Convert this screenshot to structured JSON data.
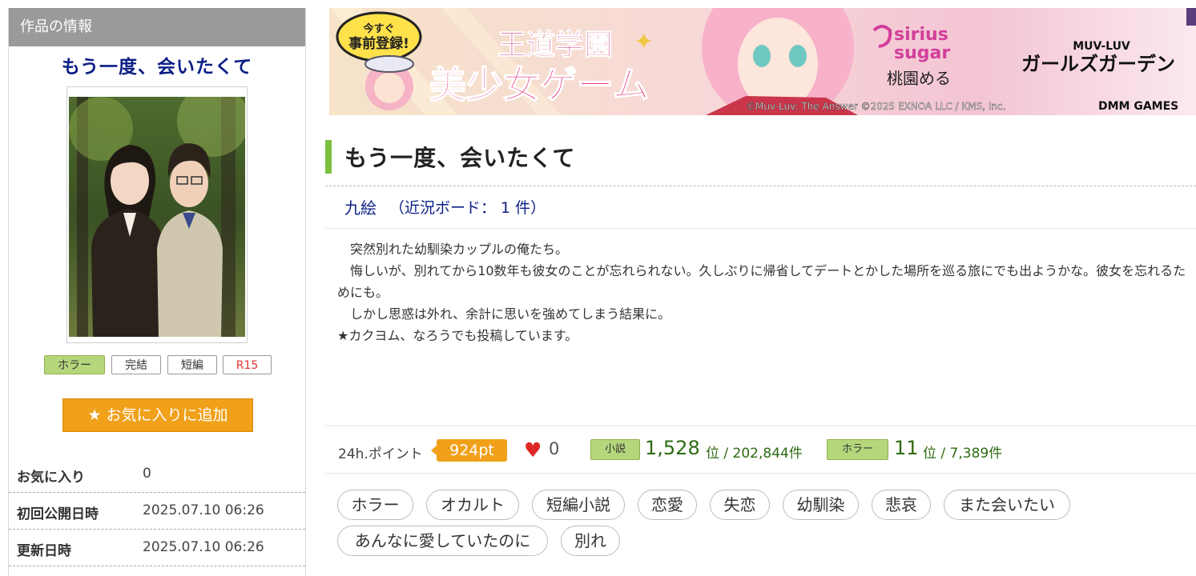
{
  "sidebar": {
    "header": "作品の情報",
    "title": "もう一度、会いたくて",
    "tags": [
      "ホラー",
      "完結",
      "短編",
      "R15"
    ],
    "favorite_button": "お気に入りに追加",
    "info": [
      {
        "label": "お気に入り",
        "value": "0"
      },
      {
        "label": "初回公開日時",
        "value": "2025.07.10 06:26"
      },
      {
        "label": "更新日時",
        "value": "2025.07.10 06:26"
      }
    ]
  },
  "banner": {
    "badge_line1": "今すぐ",
    "badge_line2": "事前登録!",
    "title1": "王道学園",
    "title2": "美少女ゲーム",
    "brand_top": "sirius",
    "brand_bottom": "sugar",
    "character": "桃園める",
    "game_top": "MUV-LUV",
    "game_name": "ガールズガーデン",
    "copyright": "©Muv-Luv: The Answer ©2025 EXNOA LLC / KMS, Inc.",
    "publisher": "DMM GAMES"
  },
  "main": {
    "title": "もう一度、会いたくて",
    "author": "九絵",
    "board": "（近況ボード： 1 件）",
    "synopsis": [
      "　突然別れた幼馴染カップルの俺たち。",
      "",
      "　悔しいが、別れてから10数年も彼女のことが忘れられない。久しぶりに帰省してデートとかした場所を巡る旅にでも出ようかな。彼女を忘れるためにも。",
      "",
      "　しかし思惑は外れ、余計に思いを強めてしまう結果に。",
      "",
      "★カクヨム、なろうでも投稿しています。"
    ],
    "stats": {
      "points_label": "24h.ポイント",
      "points": "924pt",
      "likes": "0",
      "rank1_tag": "小説",
      "rank1": "1,528",
      "rank1_suffix": "位 / 202,844件",
      "rank2_tag": "ホラー",
      "rank2": "11",
      "rank2_suffix": "位 / 7,389件"
    },
    "keywords": [
      "ホラー",
      "オカルト",
      "短編小説",
      "恋愛",
      "失恋",
      "幼馴染",
      "悲哀",
      "また会いたい",
      "あんなに愛していたのに",
      "別れ"
    ]
  },
  "colors": {
    "accent_orange": "#f1a01a",
    "accent_green": "#7cbf3f",
    "link_navy": "#0b1e86",
    "rank_green": "#2e6b12"
  }
}
